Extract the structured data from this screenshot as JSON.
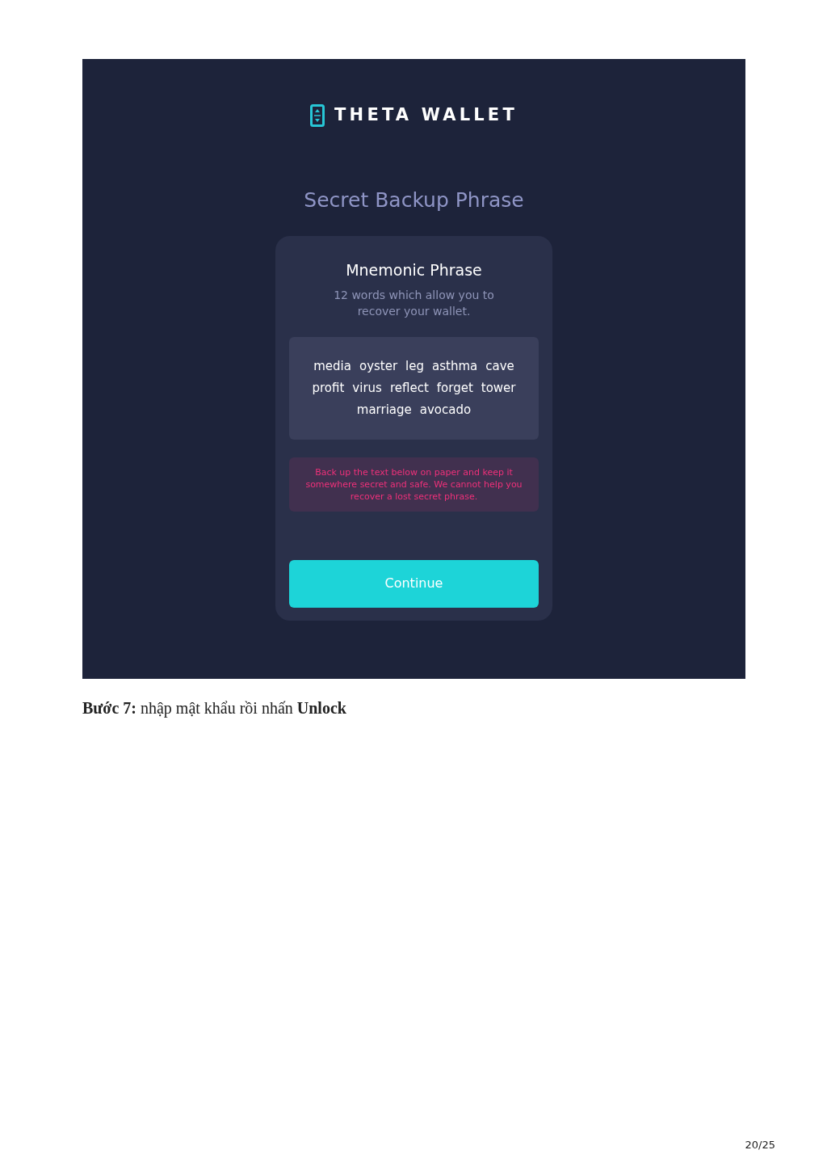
{
  "app": {
    "logo_text": "THETA WALLET",
    "heading": "Secret Backup Phrase",
    "card": {
      "title": "Mnemonic Phrase",
      "subtitle": "12 words which allow you to recover your wallet.",
      "words": [
        "media",
        "oyster",
        "leg",
        "asthma",
        "cave",
        "profit",
        "virus",
        "reflect",
        "forget",
        "tower",
        "marriage",
        "avocado"
      ],
      "warning": "Back up the text below on paper and keep it somewhere secret and safe. We cannot help you recover a lost secret phrase.",
      "button": "Continue"
    }
  },
  "caption": "**Bước 7:** nhập mật khẩu rồi nhấn **Unlock**",
  "page_number": "20/25"
}
